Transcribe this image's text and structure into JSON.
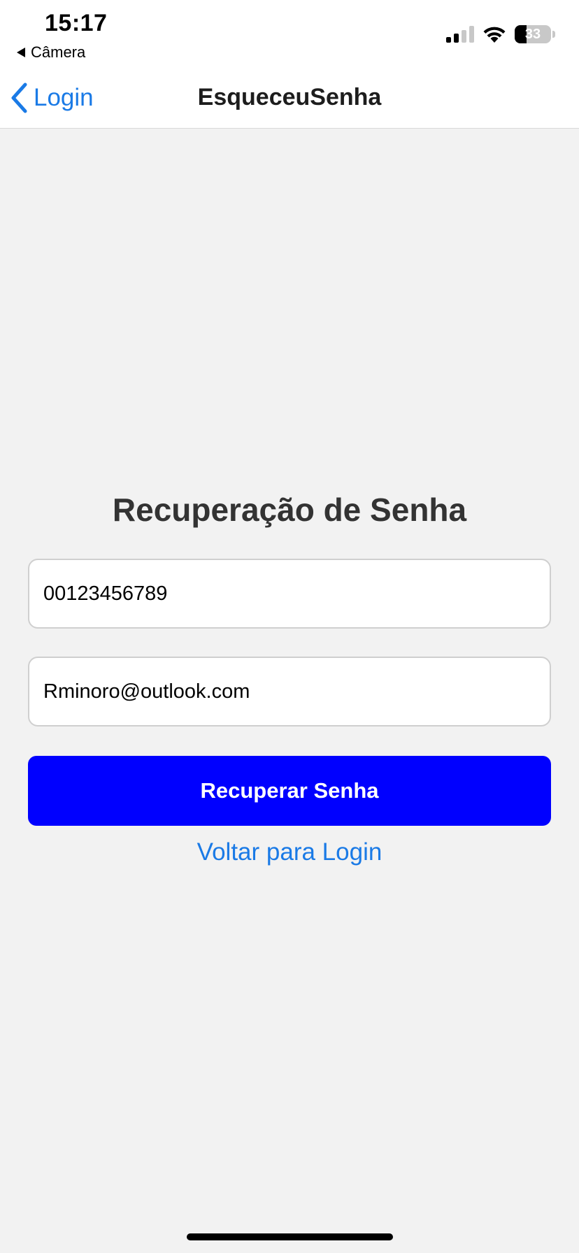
{
  "status_bar": {
    "time": "15:17",
    "back_app_label": "Câmera",
    "battery_percent": "33",
    "battery_level": 0.33,
    "signal_bars_on": 2,
    "signal_bars_total": 4,
    "wifi_icon": "wifi-icon"
  },
  "nav": {
    "back_label": "Login",
    "back_icon": "chevron-left-icon",
    "title": "EsqueceuSenha"
  },
  "form": {
    "heading": "Recuperação de Senha",
    "cpf_value": "00123456789",
    "email_value": "Rminoro@outlook.com",
    "submit_label": "Recuperar Senha",
    "back_link_label": "Voltar para Login"
  },
  "colors": {
    "accent": "#1a7ae6",
    "button": "#0000ff",
    "background": "#f2f2f2",
    "heading": "#333333"
  }
}
